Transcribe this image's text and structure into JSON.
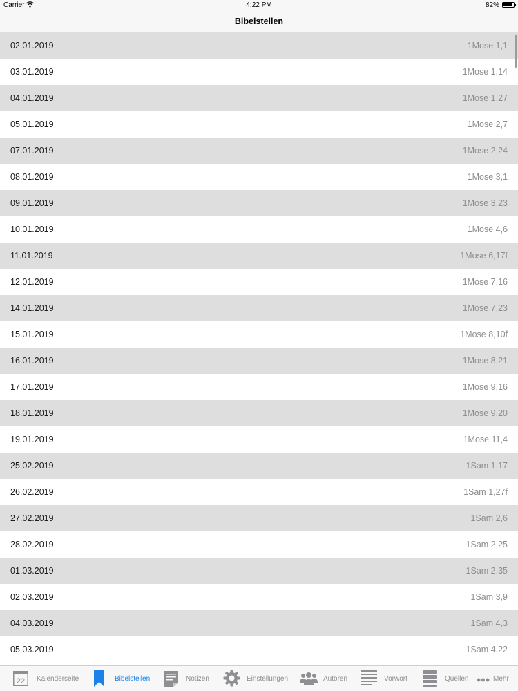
{
  "status_bar": {
    "carrier": "Carrier",
    "time": "4:22 PM",
    "battery": "82%"
  },
  "nav": {
    "title": "Bibelstellen"
  },
  "rows": [
    {
      "date": "02.01.2019",
      "ref": "1Mose 1,1"
    },
    {
      "date": "03.01.2019",
      "ref": "1Mose 1,14"
    },
    {
      "date": "04.01.2019",
      "ref": "1Mose 1,27"
    },
    {
      "date": "05.01.2019",
      "ref": "1Mose 2,7"
    },
    {
      "date": "07.01.2019",
      "ref": "1Mose 2,24"
    },
    {
      "date": "08.01.2019",
      "ref": "1Mose 3,1"
    },
    {
      "date": "09.01.2019",
      "ref": "1Mose 3,23"
    },
    {
      "date": "10.01.2019",
      "ref": "1Mose 4,6"
    },
    {
      "date": "11.01.2019",
      "ref": "1Mose 6,17f"
    },
    {
      "date": "12.01.2019",
      "ref": "1Mose 7,16"
    },
    {
      "date": "14.01.2019",
      "ref": "1Mose 7,23"
    },
    {
      "date": "15.01.2019",
      "ref": "1Mose 8,10f"
    },
    {
      "date": "16.01.2019",
      "ref": "1Mose 8,21"
    },
    {
      "date": "17.01.2019",
      "ref": "1Mose 9,16"
    },
    {
      "date": "18.01.2019",
      "ref": "1Mose 9,20"
    },
    {
      "date": "19.01.2019",
      "ref": "1Mose 11,4"
    },
    {
      "date": "25.02.2019",
      "ref": "1Sam 1,17"
    },
    {
      "date": "26.02.2019",
      "ref": "1Sam 1,27f"
    },
    {
      "date": "27.02.2019",
      "ref": "1Sam 2,6"
    },
    {
      "date": "28.02.2019",
      "ref": "1Sam 2,25"
    },
    {
      "date": "01.03.2019",
      "ref": "1Sam 2,35"
    },
    {
      "date": "02.03.2019",
      "ref": "1Sam 3,9"
    },
    {
      "date": "04.03.2019",
      "ref": "1Sam 4,3"
    },
    {
      "date": "05.03.2019",
      "ref": "1Sam 4,22"
    }
  ],
  "tabs": [
    {
      "label": "Kalenderseite",
      "icon": "calendar-icon",
      "icon_text": "22",
      "active": false
    },
    {
      "label": "Bibelstellen",
      "icon": "bookmark-icon",
      "active": true
    },
    {
      "label": "Notizen",
      "icon": "note-icon",
      "active": false
    },
    {
      "label": "Einstellungen",
      "icon": "gear-icon",
      "active": false
    },
    {
      "label": "Autoren",
      "icon": "people-icon",
      "active": false
    },
    {
      "label": "Vorwort",
      "icon": "text-lines-icon",
      "active": false
    },
    {
      "label": "Quellen",
      "icon": "books-icon",
      "active": false
    },
    {
      "label": "Mehr",
      "icon": "more-icon",
      "active": false
    }
  ],
  "colors": {
    "accent": "#1a82e8",
    "inactive": "#8e8e93",
    "row_shaded": "#dededf",
    "row_plain": "#ffffff"
  }
}
